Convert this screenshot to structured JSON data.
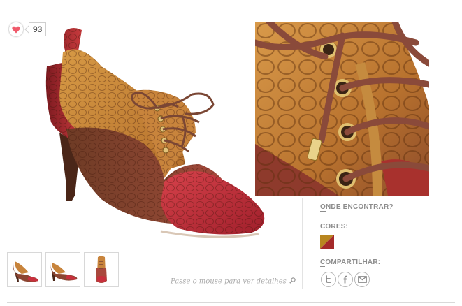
{
  "like": {
    "count": "93",
    "icon": "heart-icon",
    "heart_color": "#f05a6b"
  },
  "product": {
    "main_image_alt": "",
    "thumbnails": [
      "thumb-side",
      "thumb-side-2",
      "thumb-front"
    ]
  },
  "hint": {
    "text": "Passe o mouse para ver detalhes",
    "icon": "magnifier-icon"
  },
  "right": {
    "where_label_first": "O",
    "where_label_rest": "NDE ENCONTRAR?",
    "colors_label_first": "C",
    "colors_label_rest": "ORES:",
    "share_label_first": "C",
    "share_label_rest": "OMPARTILHAR:",
    "swatch_colors": [
      "#b8861f",
      "#a52a2a"
    ],
    "social_icons": [
      "twitter-icon",
      "facebook-icon",
      "email-icon"
    ]
  }
}
